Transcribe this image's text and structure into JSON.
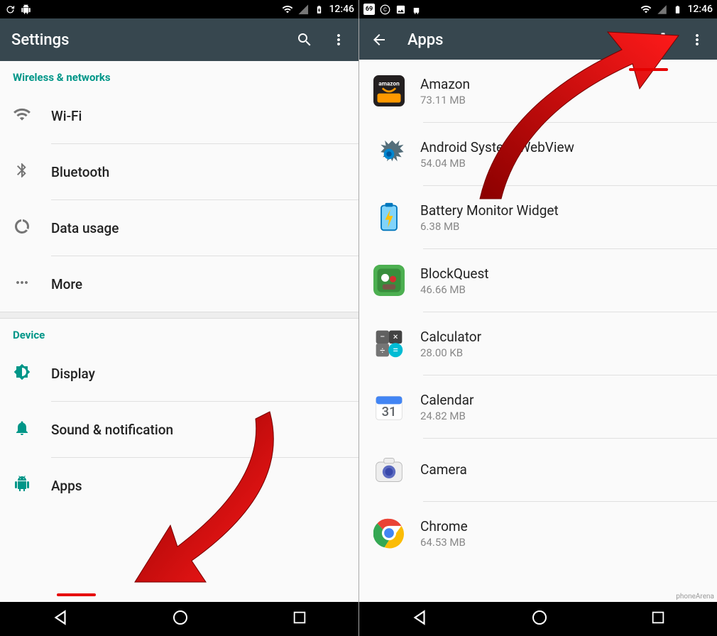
{
  "status": {
    "time": "12:46"
  },
  "left": {
    "title": "Settings",
    "sections": [
      {
        "header": "Wireless & networks",
        "items": [
          {
            "icon": "wifi",
            "label": "Wi-Fi"
          },
          {
            "icon": "bluetooth",
            "label": "Bluetooth"
          },
          {
            "icon": "data",
            "label": "Data usage"
          },
          {
            "icon": "more",
            "label": "More"
          }
        ]
      },
      {
        "header": "Device",
        "items": [
          {
            "icon": "display",
            "label": "Display"
          },
          {
            "icon": "sound",
            "label": "Sound & notification"
          },
          {
            "icon": "apps",
            "label": "Apps"
          }
        ]
      }
    ]
  },
  "right": {
    "title": "Apps",
    "apps": [
      {
        "name": "Amazon",
        "size": "73.11 MB",
        "icon": "amazon"
      },
      {
        "name": "Android System WebView",
        "size": "54.04 MB",
        "icon": "webview"
      },
      {
        "name": "Battery Monitor Widget",
        "size": "6.38 MB",
        "icon": "battery"
      },
      {
        "name": "BlockQuest",
        "size": "46.66 MB",
        "icon": "blockquest"
      },
      {
        "name": "Calculator",
        "size": "28.00 KB",
        "icon": "calculator"
      },
      {
        "name": "Calendar",
        "size": "24.82 MB",
        "icon": "calendar"
      },
      {
        "name": "Camera",
        "size": "",
        "icon": "camera"
      },
      {
        "name": "Chrome",
        "size": "64.53 MB",
        "icon": "chrome"
      }
    ]
  },
  "watermark": "phoneArena"
}
